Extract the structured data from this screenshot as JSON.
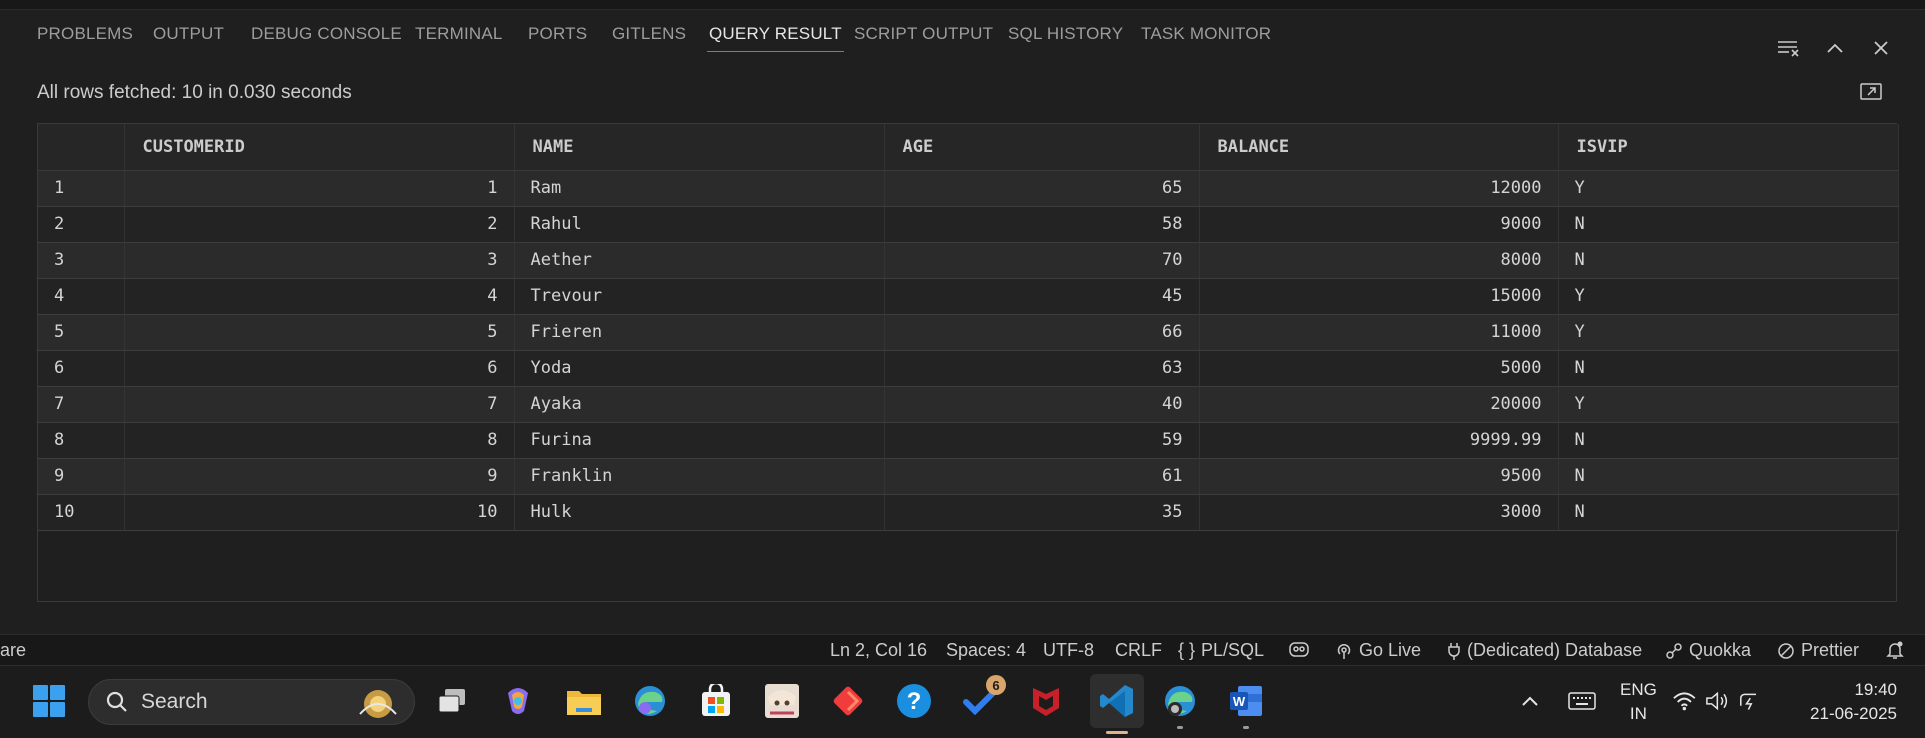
{
  "panel": {
    "tabs": [
      {
        "label": "PROBLEMS"
      },
      {
        "label": "OUTPUT"
      },
      {
        "label": "DEBUG CONSOLE"
      },
      {
        "label": "TERMINAL"
      },
      {
        "label": "PORTS"
      },
      {
        "label": "GITLENS"
      },
      {
        "label": "QUERY RESULT"
      },
      {
        "label": "SCRIPT OUTPUT"
      },
      {
        "label": "SQL HISTORY"
      },
      {
        "label": "TASK MONITOR"
      }
    ],
    "active_tab": "QUERY RESULT",
    "actions": [
      "clear-output-icon",
      "chevron-up-icon",
      "close-icon"
    ]
  },
  "query_result": {
    "summary": "All rows fetched: 10 in 0.030 seconds",
    "columns": [
      "",
      "CUSTOMERID",
      "NAME",
      "AGE",
      "BALANCE",
      "ISVIP"
    ],
    "rows": [
      [
        "1",
        "1",
        "Ram",
        "65",
        "12000",
        "Y"
      ],
      [
        "2",
        "2",
        "Rahul",
        "58",
        "9000",
        "N"
      ],
      [
        "3",
        "3",
        "Aether",
        "70",
        "8000",
        "N"
      ],
      [
        "4",
        "4",
        "Trevour",
        "45",
        "15000",
        "Y"
      ],
      [
        "5",
        "5",
        "Frieren",
        "66",
        "11000",
        "Y"
      ],
      [
        "6",
        "6",
        "Yoda",
        "63",
        "5000",
        "N"
      ],
      [
        "7",
        "7",
        "Ayaka",
        "40",
        "20000",
        "Y"
      ],
      [
        "8",
        "8",
        "Furina",
        "59",
        "9999.99",
        "N"
      ],
      [
        "9",
        "9",
        "Franklin",
        "61",
        "9500",
        "N"
      ],
      [
        "10",
        "10",
        "Hulk",
        "35",
        "3000",
        "N"
      ]
    ]
  },
  "statusbar": {
    "left_text": "are",
    "position": "Ln 2, Col 16",
    "spaces": "Spaces: 4",
    "encoding": "UTF-8",
    "eol": "CRLF",
    "language": "PL/SQL",
    "language_prefix": "{ }",
    "go_live": "Go Live",
    "database": "(Dedicated) Database",
    "quokka": "Quokka",
    "prettier": "Prettier"
  },
  "taskbar": {
    "search_label": "Search",
    "tasks_badge": "6",
    "lang_line1": "ENG",
    "lang_line2": "IN",
    "time": "19:40",
    "date": "21-06-2025"
  },
  "colors": {
    "accent": "#3f8ae0",
    "panel_bg": "#1f1f1f",
    "row_odd": "#2b2b2b",
    "row_even": "#232323"
  }
}
